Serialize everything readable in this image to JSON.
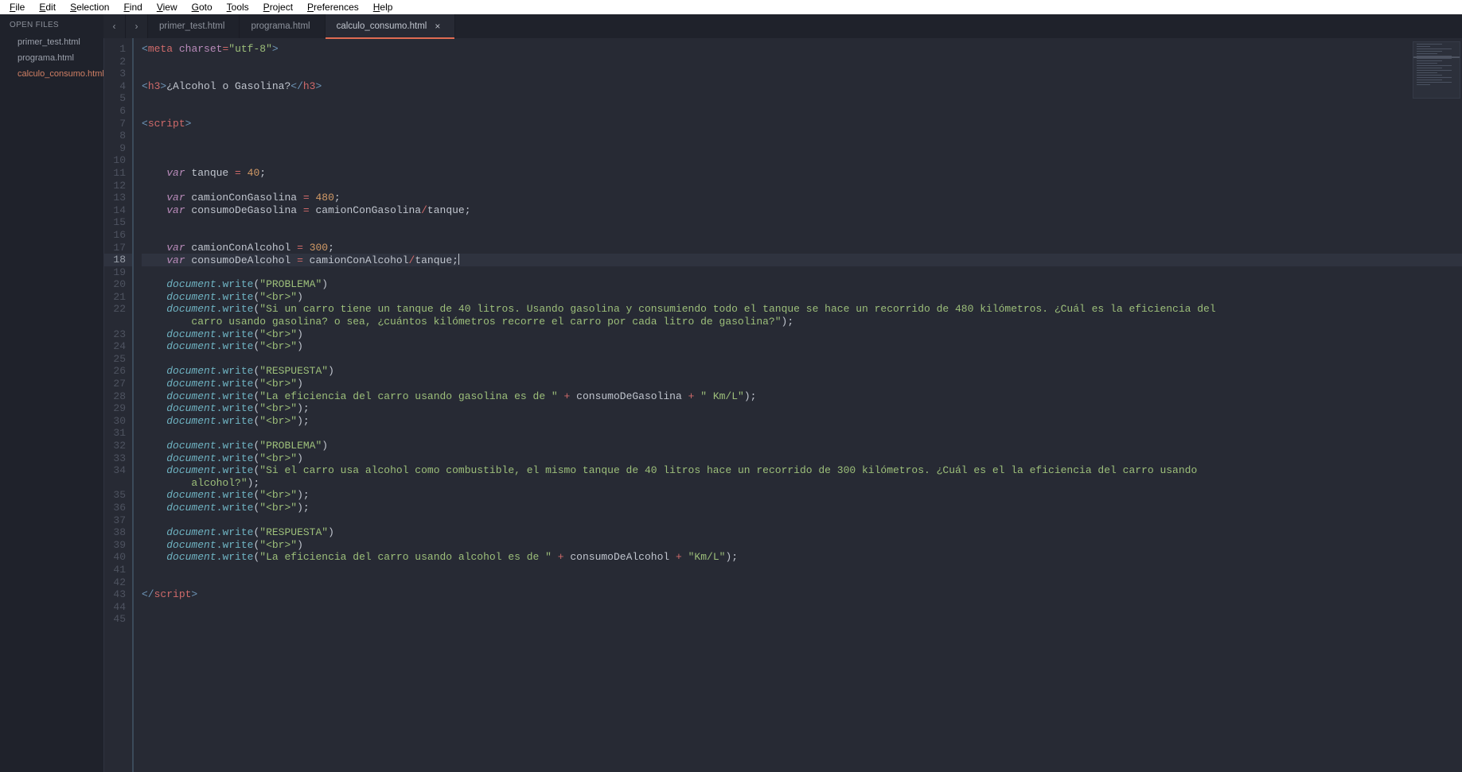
{
  "menubar": [
    {
      "label": "File",
      "ul": "F",
      "rest": "ile"
    },
    {
      "label": "Edit",
      "ul": "E",
      "rest": "dit"
    },
    {
      "label": "Selection",
      "ul": "S",
      "rest": "election"
    },
    {
      "label": "Find",
      "ul": "F",
      "rest": "ind"
    },
    {
      "label": "View",
      "ul": "V",
      "rest": "iew"
    },
    {
      "label": "Goto",
      "ul": "G",
      "rest": "oto"
    },
    {
      "label": "Tools",
      "ul": "T",
      "rest": "ools"
    },
    {
      "label": "Project",
      "ul": "P",
      "rest": "roject"
    },
    {
      "label": "Preferences",
      "ul": "P",
      "rest": "references"
    },
    {
      "label": "Help",
      "ul": "H",
      "rest": "elp"
    }
  ],
  "nav": {
    "back": "‹",
    "fwd": "›"
  },
  "sidebar": {
    "heading": "OPEN FILES",
    "files": [
      {
        "name": "primer_test.html",
        "active": false
      },
      {
        "name": "programa.html",
        "active": false
      },
      {
        "name": "calculo_consumo.html",
        "active": true
      }
    ]
  },
  "tabs": [
    {
      "name": "primer_test.html",
      "active": false,
      "closable": false
    },
    {
      "name": "programa.html",
      "active": false,
      "closable": false
    },
    {
      "name": "calculo_consumo.html",
      "active": true,
      "closable": true
    }
  ],
  "close_glyph": "×",
  "editor": {
    "highlighted_line": 18,
    "line_count": 45,
    "lines": [
      {
        "n": 1,
        "t": [
          [
            "pun",
            "<"
          ],
          [
            "tag",
            "meta"
          ],
          [
            "plain",
            " "
          ],
          [
            "attr",
            "charset"
          ],
          [
            "op",
            "="
          ],
          [
            "str",
            "\"utf-8\""
          ],
          [
            "pun",
            ">"
          ]
        ]
      },
      {
        "n": 2,
        "t": []
      },
      {
        "n": 3,
        "t": []
      },
      {
        "n": 4,
        "t": [
          [
            "pun",
            "<"
          ],
          [
            "tag",
            "h3"
          ],
          [
            "pun",
            ">"
          ],
          [
            "plain",
            "¿Alcohol o Gasolina?"
          ],
          [
            "pun",
            "</"
          ],
          [
            "tag",
            "h3"
          ],
          [
            "pun",
            ">"
          ]
        ]
      },
      {
        "n": 5,
        "t": []
      },
      {
        "n": 6,
        "t": []
      },
      {
        "n": 7,
        "t": [
          [
            "pun",
            "<"
          ],
          [
            "tag",
            "script"
          ],
          [
            "pun",
            ">"
          ]
        ]
      },
      {
        "n": 8,
        "t": []
      },
      {
        "n": 9,
        "t": []
      },
      {
        "n": 10,
        "t": []
      },
      {
        "n": 11,
        "t": [
          [
            "plain",
            "    "
          ],
          [
            "kw",
            "var"
          ],
          [
            "plain",
            " tanque "
          ],
          [
            "op",
            "="
          ],
          [
            "plain",
            " "
          ],
          [
            "num",
            "40"
          ],
          [
            "plain",
            ";"
          ]
        ]
      },
      {
        "n": 12,
        "t": []
      },
      {
        "n": 13,
        "t": [
          [
            "plain",
            "    "
          ],
          [
            "kw",
            "var"
          ],
          [
            "plain",
            " camionConGasolina "
          ],
          [
            "op",
            "="
          ],
          [
            "plain",
            " "
          ],
          [
            "num",
            "480"
          ],
          [
            "plain",
            ";"
          ]
        ]
      },
      {
        "n": 14,
        "t": [
          [
            "plain",
            "    "
          ],
          [
            "kw",
            "var"
          ],
          [
            "plain",
            " consumoDeGasolina "
          ],
          [
            "op",
            "="
          ],
          [
            "plain",
            " camionConGasolina"
          ],
          [
            "op",
            "/"
          ],
          [
            "plain",
            "tanque;"
          ]
        ]
      },
      {
        "n": 15,
        "t": []
      },
      {
        "n": 16,
        "t": []
      },
      {
        "n": 17,
        "t": [
          [
            "plain",
            "    "
          ],
          [
            "kw",
            "var"
          ],
          [
            "plain",
            " camionConAlcohol "
          ],
          [
            "op",
            "="
          ],
          [
            "plain",
            " "
          ],
          [
            "num",
            "300"
          ],
          [
            "plain",
            ";"
          ]
        ]
      },
      {
        "n": 18,
        "t": [
          [
            "plain",
            "    "
          ],
          [
            "kw",
            "var"
          ],
          [
            "plain",
            " consumoDeAlcohol "
          ],
          [
            "op",
            "="
          ],
          [
            "plain",
            " camionConAlcohol"
          ],
          [
            "op",
            "/"
          ],
          [
            "plain",
            "tanque;"
          ]
        ],
        "cursor": true
      },
      {
        "n": 19,
        "t": []
      },
      {
        "n": 20,
        "t": [
          [
            "plain",
            "    "
          ],
          [
            "obj",
            "document"
          ],
          [
            "meth",
            ".write"
          ],
          [
            "plain",
            "("
          ],
          [
            "str",
            "\"PROBLEMA\""
          ],
          [
            "plain",
            ")"
          ]
        ]
      },
      {
        "n": 21,
        "t": [
          [
            "plain",
            "    "
          ],
          [
            "obj",
            "document"
          ],
          [
            "meth",
            ".write"
          ],
          [
            "plain",
            "("
          ],
          [
            "str",
            "\"<br>\""
          ],
          [
            "plain",
            ")"
          ]
        ]
      },
      {
        "n": 22,
        "t": [
          [
            "plain",
            "    "
          ],
          [
            "obj",
            "document"
          ],
          [
            "meth",
            ".write"
          ],
          [
            "plain",
            "("
          ],
          [
            "str",
            "\"Si un carro tiene un tanque de 40 litros. Usando gasolina y consumiendo todo el tanque se hace un recorrido de 480 kilómetros. ¿Cuál es la eficiencia del "
          ]
        ]
      },
      {
        "n": "22b",
        "t": [
          [
            "str",
            "        carro usando gasolina? o sea, ¿cuántos kilómetros recorre el carro por cada litro de gasolina?\""
          ],
          [
            "plain",
            ");"
          ]
        ]
      },
      {
        "n": 23,
        "t": [
          [
            "plain",
            "    "
          ],
          [
            "obj",
            "document"
          ],
          [
            "meth",
            ".write"
          ],
          [
            "plain",
            "("
          ],
          [
            "str",
            "\"<br>\""
          ],
          [
            "plain",
            ")"
          ]
        ]
      },
      {
        "n": 24,
        "t": [
          [
            "plain",
            "    "
          ],
          [
            "obj",
            "document"
          ],
          [
            "meth",
            ".write"
          ],
          [
            "plain",
            "("
          ],
          [
            "str",
            "\"<br>\""
          ],
          [
            "plain",
            ")"
          ]
        ]
      },
      {
        "n": 25,
        "t": []
      },
      {
        "n": 26,
        "t": [
          [
            "plain",
            "    "
          ],
          [
            "obj",
            "document"
          ],
          [
            "meth",
            ".write"
          ],
          [
            "plain",
            "("
          ],
          [
            "str",
            "\"RESPUESTA\""
          ],
          [
            "plain",
            ")"
          ]
        ]
      },
      {
        "n": 27,
        "t": [
          [
            "plain",
            "    "
          ],
          [
            "obj",
            "document"
          ],
          [
            "meth",
            ".write"
          ],
          [
            "plain",
            "("
          ],
          [
            "str",
            "\"<br>\""
          ],
          [
            "plain",
            ")"
          ]
        ]
      },
      {
        "n": 28,
        "t": [
          [
            "plain",
            "    "
          ],
          [
            "obj",
            "document"
          ],
          [
            "meth",
            ".write"
          ],
          [
            "plain",
            "("
          ],
          [
            "str",
            "\"La eficiencia del carro usando gasolina es de \""
          ],
          [
            "plain",
            " "
          ],
          [
            "op",
            "+"
          ],
          [
            "plain",
            " consumoDeGasolina "
          ],
          [
            "op",
            "+"
          ],
          [
            "plain",
            " "
          ],
          [
            "str",
            "\" Km/L\""
          ],
          [
            "plain",
            ");"
          ]
        ]
      },
      {
        "n": 29,
        "t": [
          [
            "plain",
            "    "
          ],
          [
            "obj",
            "document"
          ],
          [
            "meth",
            ".write"
          ],
          [
            "plain",
            "("
          ],
          [
            "str",
            "\"<br>\""
          ],
          [
            "plain",
            ");"
          ]
        ]
      },
      {
        "n": 30,
        "t": [
          [
            "plain",
            "    "
          ],
          [
            "obj",
            "document"
          ],
          [
            "meth",
            ".write"
          ],
          [
            "plain",
            "("
          ],
          [
            "str",
            "\"<br>\""
          ],
          [
            "plain",
            ");"
          ]
        ]
      },
      {
        "n": 31,
        "t": []
      },
      {
        "n": 32,
        "t": [
          [
            "plain",
            "    "
          ],
          [
            "obj",
            "document"
          ],
          [
            "meth",
            ".write"
          ],
          [
            "plain",
            "("
          ],
          [
            "str",
            "\"PROBLEMA\""
          ],
          [
            "plain",
            ")"
          ]
        ]
      },
      {
        "n": 33,
        "t": [
          [
            "plain",
            "    "
          ],
          [
            "obj",
            "document"
          ],
          [
            "meth",
            ".write"
          ],
          [
            "plain",
            "("
          ],
          [
            "str",
            "\"<br>\""
          ],
          [
            "plain",
            ")"
          ]
        ]
      },
      {
        "n": 34,
        "t": [
          [
            "plain",
            "    "
          ],
          [
            "obj",
            "document"
          ],
          [
            "meth",
            ".write"
          ],
          [
            "plain",
            "("
          ],
          [
            "str",
            "\"Si el carro usa alcohol como combustible, el mismo tanque de 40 litros hace un recorrido de 300 kilómetros. ¿Cuál es el la eficiencia del carro usando "
          ]
        ]
      },
      {
        "n": "34b",
        "t": [
          [
            "str",
            "        alcohol?\""
          ],
          [
            "plain",
            ");"
          ]
        ]
      },
      {
        "n": 35,
        "t": [
          [
            "plain",
            "    "
          ],
          [
            "obj",
            "document"
          ],
          [
            "meth",
            ".write"
          ],
          [
            "plain",
            "("
          ],
          [
            "str",
            "\"<br>\""
          ],
          [
            "plain",
            ");"
          ]
        ]
      },
      {
        "n": 36,
        "t": [
          [
            "plain",
            "    "
          ],
          [
            "obj",
            "document"
          ],
          [
            "meth",
            ".write"
          ],
          [
            "plain",
            "("
          ],
          [
            "str",
            "\"<br>\""
          ],
          [
            "plain",
            ");"
          ]
        ]
      },
      {
        "n": 37,
        "t": []
      },
      {
        "n": 38,
        "t": [
          [
            "plain",
            "    "
          ],
          [
            "obj",
            "document"
          ],
          [
            "meth",
            ".write"
          ],
          [
            "plain",
            "("
          ],
          [
            "str",
            "\"RESPUESTA\""
          ],
          [
            "plain",
            ")"
          ]
        ]
      },
      {
        "n": 39,
        "t": [
          [
            "plain",
            "    "
          ],
          [
            "obj",
            "document"
          ],
          [
            "meth",
            ".write"
          ],
          [
            "plain",
            "("
          ],
          [
            "str",
            "\"<br>\""
          ],
          [
            "plain",
            ")"
          ]
        ]
      },
      {
        "n": 40,
        "t": [
          [
            "plain",
            "    "
          ],
          [
            "obj",
            "document"
          ],
          [
            "meth",
            ".write"
          ],
          [
            "plain",
            "("
          ],
          [
            "str",
            "\"La eficiencia del carro usando alcohol es de \""
          ],
          [
            "plain",
            " "
          ],
          [
            "op",
            "+"
          ],
          [
            "plain",
            " consumoDeAlcohol "
          ],
          [
            "op",
            "+"
          ],
          [
            "plain",
            " "
          ],
          [
            "str",
            "\"Km/L\""
          ],
          [
            "plain",
            ");"
          ]
        ]
      },
      {
        "n": 41,
        "t": []
      },
      {
        "n": 42,
        "t": []
      },
      {
        "n": 43,
        "t": [
          [
            "pun",
            "</"
          ],
          [
            "tag",
            "script"
          ],
          [
            "pun",
            ">"
          ]
        ]
      },
      {
        "n": 44,
        "t": []
      },
      {
        "n": 45,
        "t": []
      }
    ]
  }
}
